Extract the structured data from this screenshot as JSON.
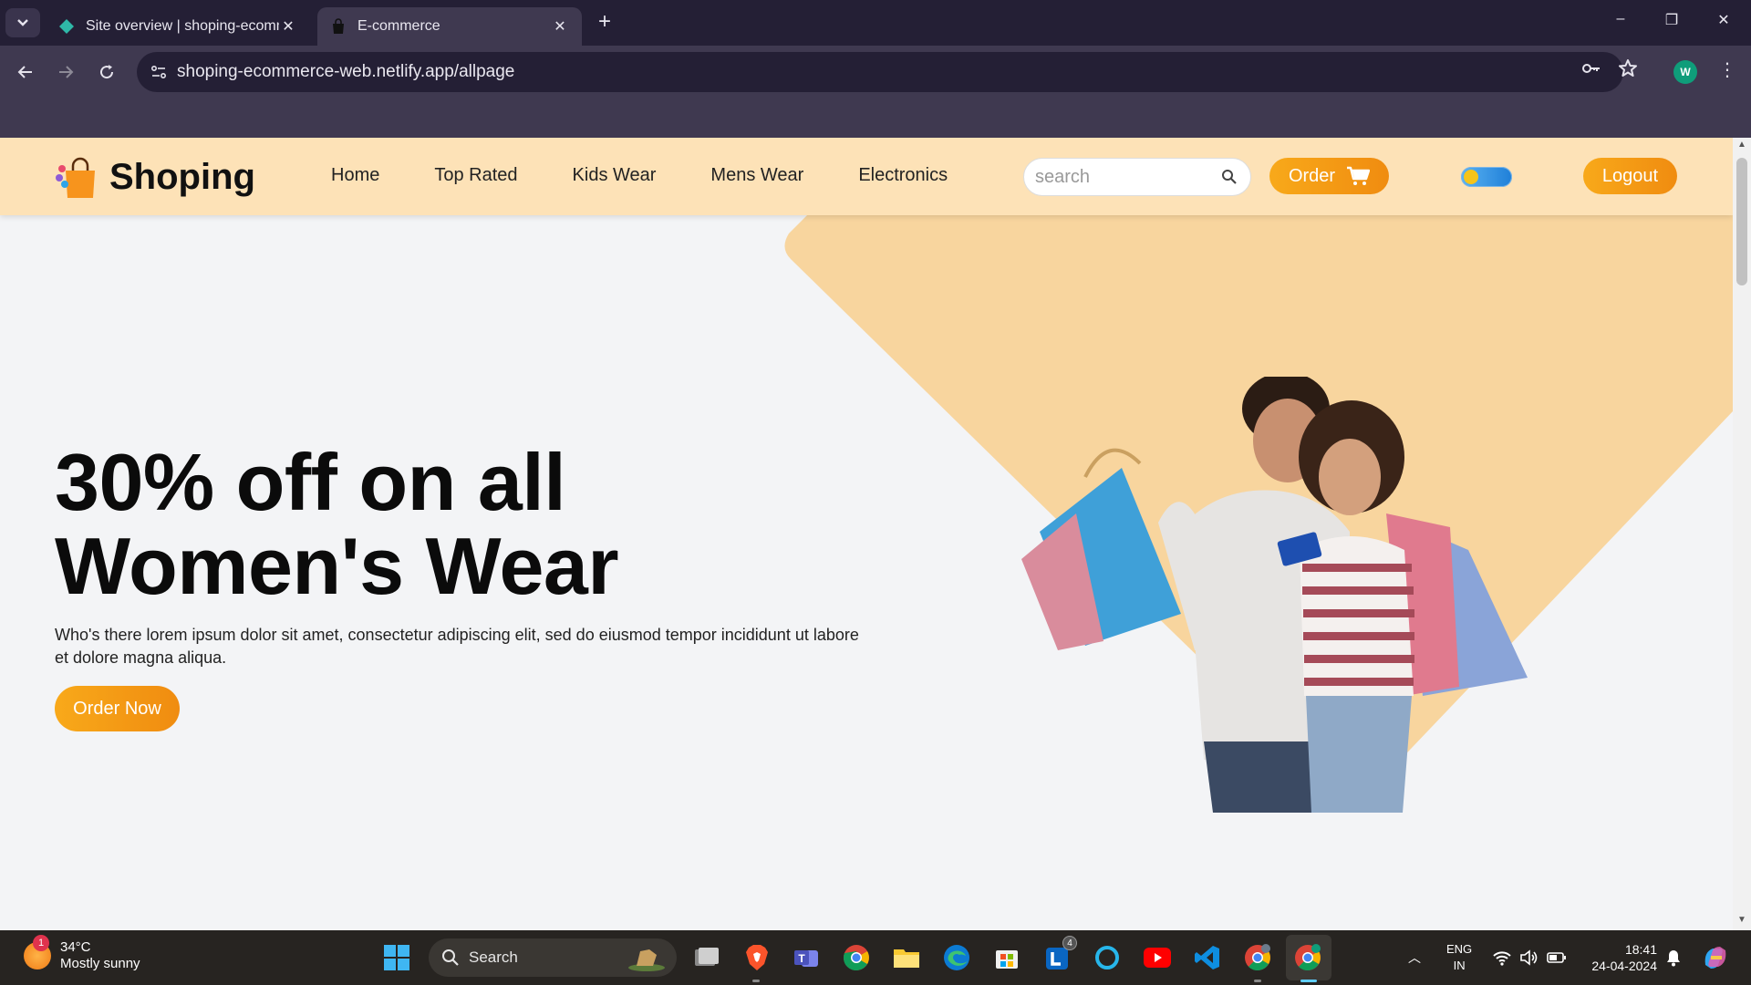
{
  "browser": {
    "tabs": [
      {
        "title": "Site overview | shoping-ecomm",
        "active": false,
        "icon": "netlify-diamond-icon"
      },
      {
        "title": "E-commerce",
        "active": true,
        "icon": "shopping-bag-icon"
      }
    ],
    "new_tab_label": "+",
    "url": "shoping-ecommerce-web.netlify.app/allpage",
    "profile_initial": "W",
    "window_controls": {
      "minimize": "–",
      "restore": "❐",
      "close": "✕"
    }
  },
  "site": {
    "brand": "Shoping",
    "nav": [
      "Home",
      "Top Rated",
      "Kids Wear",
      "Mens Wear",
      "Electronics"
    ],
    "search_placeholder": "search",
    "order_label": "Order",
    "logout_label": "Logout",
    "theme_toggle": {
      "state": "light"
    },
    "hero": {
      "title_line1": "30% off on all",
      "title_line2": "Women's Wear",
      "description": "Who's there lorem ipsum dolor sit amet, consectetur adipiscing elit, sed do eiusmod tempor incididunt ut labore et dolore magna aliqua.",
      "cta": "Order Now"
    },
    "colors": {
      "header_bg": "#fde2b7",
      "accent": "#f8a91a",
      "hero_shape": "#f8d59e",
      "page_bg": "#f3f4f6"
    }
  },
  "taskbar": {
    "weather": {
      "temp": "34°C",
      "desc": "Mostly sunny",
      "badge": "1"
    },
    "search_label": "Search",
    "apps": [
      "file-explorer-gallery",
      "brave",
      "teams",
      "chrome",
      "file-explorer",
      "edge",
      "microsoft-store",
      "linkedin",
      "cortana",
      "youtube",
      "vscode",
      "chrome-profile",
      "chrome-active"
    ],
    "linkedin_badge": "4",
    "lang_line1": "ENG",
    "lang_line2": "IN",
    "time": "18:41",
    "date": "24-04-2024"
  }
}
